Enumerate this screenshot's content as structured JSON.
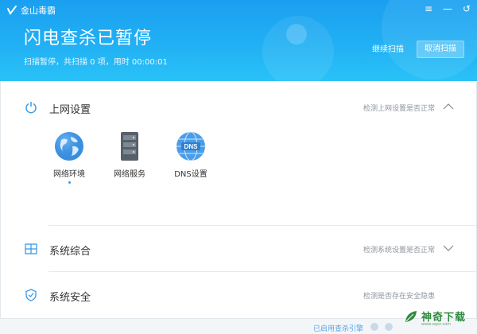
{
  "app": {
    "logo_text": "金山毒霸",
    "window_controls": [
      "≡",
      "—",
      "↺"
    ]
  },
  "header": {
    "title": "闪电查杀已暂停",
    "status": "扫描暂停，共扫描 0 项，用时 00:00:01",
    "continue_label": "继续扫描",
    "cancel_label": "取消扫描"
  },
  "sections": [
    {
      "title": "上网设置",
      "status": "检测上网设置是否正常",
      "icon": "power-icon",
      "expanded": true,
      "tools": [
        {
          "label": "网络环境",
          "icon": "globe-icon"
        },
        {
          "label": "网络服务",
          "icon": "server-icon"
        },
        {
          "label": "DNS设置",
          "icon": "dns-globe-icon"
        }
      ]
    },
    {
      "title": "系统综合",
      "status": "检测系统设置是否正常",
      "icon": "windows-icon",
      "expanded": false
    },
    {
      "title": "系统安全",
      "status": "检测是否存在安全隐患",
      "icon": "shield-icon",
      "expanded": false
    }
  ],
  "footer": {
    "text": "已启用查杀引擎"
  },
  "watermark": {
    "text": "神奇下载",
    "url": "www.sqxz.com"
  },
  "colors": {
    "header_top": "#1a9ff0",
    "header_bottom": "#2ac2f8",
    "accent": "#2196e8"
  }
}
